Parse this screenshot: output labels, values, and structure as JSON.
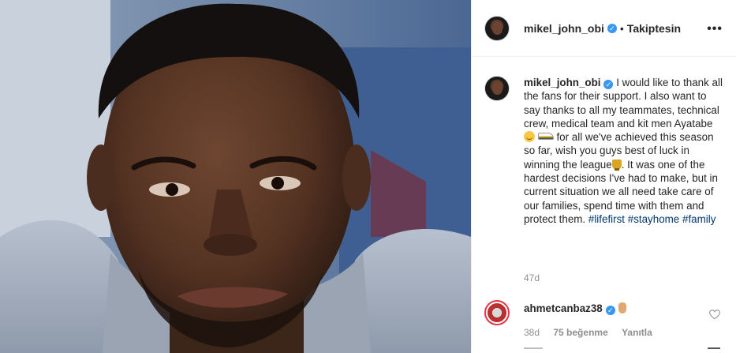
{
  "post": {
    "username": "mikel_john_obi",
    "follow_status": "Takiptesin",
    "separator": "•",
    "more_icon": "more-horizontal-icon",
    "more_label": "•••",
    "verified_mark": "✓",
    "caption_segments": {
      "a": "I would like to thank all the fans for their support. I also want to say thanks to all my teammates, technical crew, medical team and kit men Ayatabe ",
      "b": " for all we've achieved this season so far, wish you guys best of luck in winning the league",
      "c": ". It was one of the hardest decisions I've had to make, but in current situation we all need take care of our families, spend time with them and protect them. ",
      "tag1": "#lifefirst",
      "tag2": "#stayhome",
      "tag3": "#family"
    },
    "time": "47d"
  },
  "comment": {
    "username": "ahmetcanbaz38",
    "time": "38d",
    "likes": "75 beğenme",
    "reply": "Yanıtla"
  },
  "colors": {
    "verified": "#3897f0",
    "hashtag": "#00376b",
    "muted": "#8e8e8e",
    "border": "#efefef"
  }
}
